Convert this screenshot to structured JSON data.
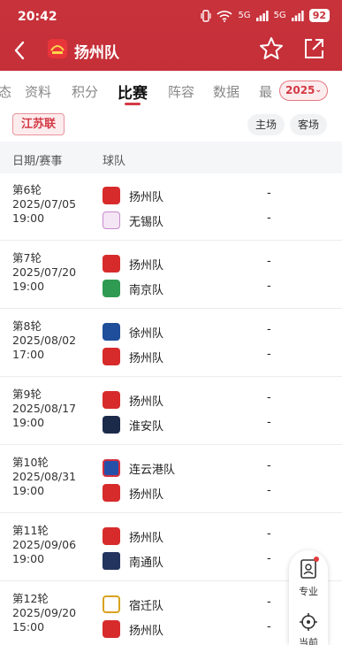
{
  "status_bar": {
    "time": "20:42",
    "net1": "5G",
    "net2": "5G",
    "battery": "92"
  },
  "header": {
    "title": "扬州队"
  },
  "tabs": [
    {
      "label": "态"
    },
    {
      "label": "资料"
    },
    {
      "label": "积分"
    },
    {
      "label": "比赛"
    },
    {
      "label": "阵容"
    },
    {
      "label": "数据"
    },
    {
      "label": "最"
    }
  ],
  "season": "2025",
  "filters": {
    "league": "江苏联",
    "home": "主场",
    "away": "客场"
  },
  "columns": {
    "date": "日期/赛事",
    "team": "球队"
  },
  "matches": [
    {
      "round": "第6轮",
      "date": "2025/07/05",
      "time": "19:00",
      "home": "扬州队",
      "away": "无锡队",
      "home_score": "-",
      "away_score": "-"
    },
    {
      "round": "第7轮",
      "date": "2025/07/20",
      "time": "19:00",
      "home": "扬州队",
      "away": "南京队",
      "home_score": "-",
      "away_score": "-"
    },
    {
      "round": "第8轮",
      "date": "2025/08/02",
      "time": "17:00",
      "home": "徐州队",
      "away": "扬州队",
      "home_score": "-",
      "away_score": "-"
    },
    {
      "round": "第9轮",
      "date": "2025/08/17",
      "time": "19:00",
      "home": "扬州队",
      "away": "淮安队",
      "home_score": "-",
      "away_score": "-"
    },
    {
      "round": "第10轮",
      "date": "2025/08/31",
      "time": "19:00",
      "home": "连云港队",
      "away": "扬州队",
      "home_score": "-",
      "away_score": "-"
    },
    {
      "round": "第11轮",
      "date": "2025/09/06",
      "time": "19:00",
      "home": "扬州队",
      "away": "南通队",
      "home_score": "-",
      "away_score": "-"
    },
    {
      "round": "第12轮",
      "date": "2025/09/20",
      "time": "15:00",
      "home": "宿迁队",
      "away": "扬州队",
      "home_score": "-",
      "away_score": "-"
    }
  ],
  "float_panel": {
    "pro_label": "专业",
    "current_label": "当前"
  },
  "colors": {
    "brand_red": "#c8323b",
    "accent": "#d33a44"
  }
}
